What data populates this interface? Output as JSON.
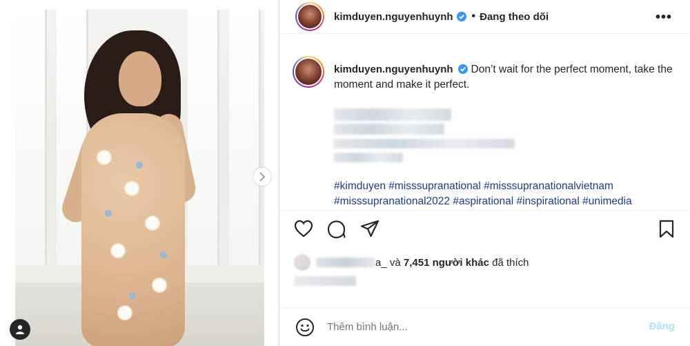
{
  "post": {
    "username": "kimduyen.nguyenhuynh",
    "follow_status": "Đang theo dõi",
    "separator": "•",
    "more_label": "•••",
    "caption_text": "Don’t wait for the perfect moment, take the moment and make it perfect.",
    "hashtags_line1": "#kimduyen #misssupranational #misssupranationalvietnam",
    "hashtags_line2": "#misssupranational2022 #aspirational #inspirational #unimedia",
    "likes_suffix_name": "a_",
    "likes_joiner": "và",
    "likes_count": "7,451 người khác",
    "likes_end": "đã thích"
  },
  "comment": {
    "placeholder": "Thêm bình luận...",
    "post_label": "Đăng"
  },
  "colors": {
    "hashtag": "#1f3c88",
    "verified": "#3897f0",
    "post_button_disabled": "#b2dffc",
    "text": "#262626",
    "muted": "#8e8e8e"
  },
  "icons": [
    "heart-icon",
    "comment-icon",
    "share-icon",
    "bookmark-icon",
    "emoji-icon",
    "more-icon",
    "verified-badge-icon",
    "chevron-right-icon",
    "user-tag-icon"
  ]
}
